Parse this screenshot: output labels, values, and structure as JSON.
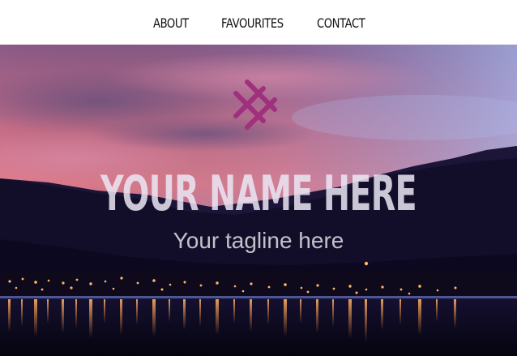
{
  "nav": {
    "items": [
      {
        "label": "ABOUT"
      },
      {
        "label": "FAVOURITES"
      },
      {
        "label": "CONTACT"
      }
    ]
  },
  "hero": {
    "logo_icon": "crosshatch-logo-icon",
    "title": "YOUR NAME HERE",
    "tagline": "Your tagline here",
    "background": "sunset-mountains-lake-town-lights"
  },
  "colors": {
    "accent": "#a0307e",
    "nav_background": "#ffffff",
    "nav_text": "#111111"
  }
}
